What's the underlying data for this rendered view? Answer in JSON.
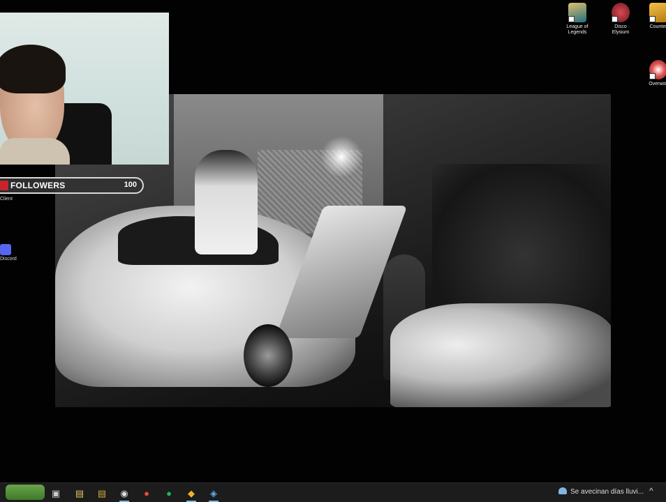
{
  "overlay": {
    "followers_label": "FOLLOWERS",
    "followers_count": "100"
  },
  "left_icons": [
    {
      "name": "Client",
      "color": "#c8242c"
    },
    {
      "name": "Discord",
      "color": "#5865f2"
    }
  ],
  "desktop_icons": [
    {
      "name": "League of Legends",
      "color": "#c89b3c"
    },
    {
      "name": "Disco Elysium",
      "color": "#b3303a"
    },
    {
      "name": "Counter",
      "color": "#e5a520"
    },
    {
      "name": "Overwolf",
      "color": "#cc3b3b"
    }
  ],
  "taskbar": {
    "items": [
      {
        "name": "task-view-icon",
        "glyph": "▣",
        "color": "#cccccc"
      },
      {
        "name": "file-explorer-icon",
        "glyph": "▤",
        "color": "#e8c15a"
      },
      {
        "name": "obs-icon",
        "glyph": "◉",
        "color": "#dddddd"
      },
      {
        "name": "chrome-icon",
        "glyph": "●",
        "color": "#e74c3c"
      },
      {
        "name": "spotify-icon",
        "glyph": "●",
        "color": "#1db954"
      },
      {
        "name": "app-icon",
        "glyph": "◆",
        "color": "#f0b429"
      },
      {
        "name": "steam-icon",
        "glyph": "◈",
        "color": "#66aee6"
      }
    ],
    "weather_text": "Se avecinan días lluvi...",
    "tray_caret": "^"
  }
}
